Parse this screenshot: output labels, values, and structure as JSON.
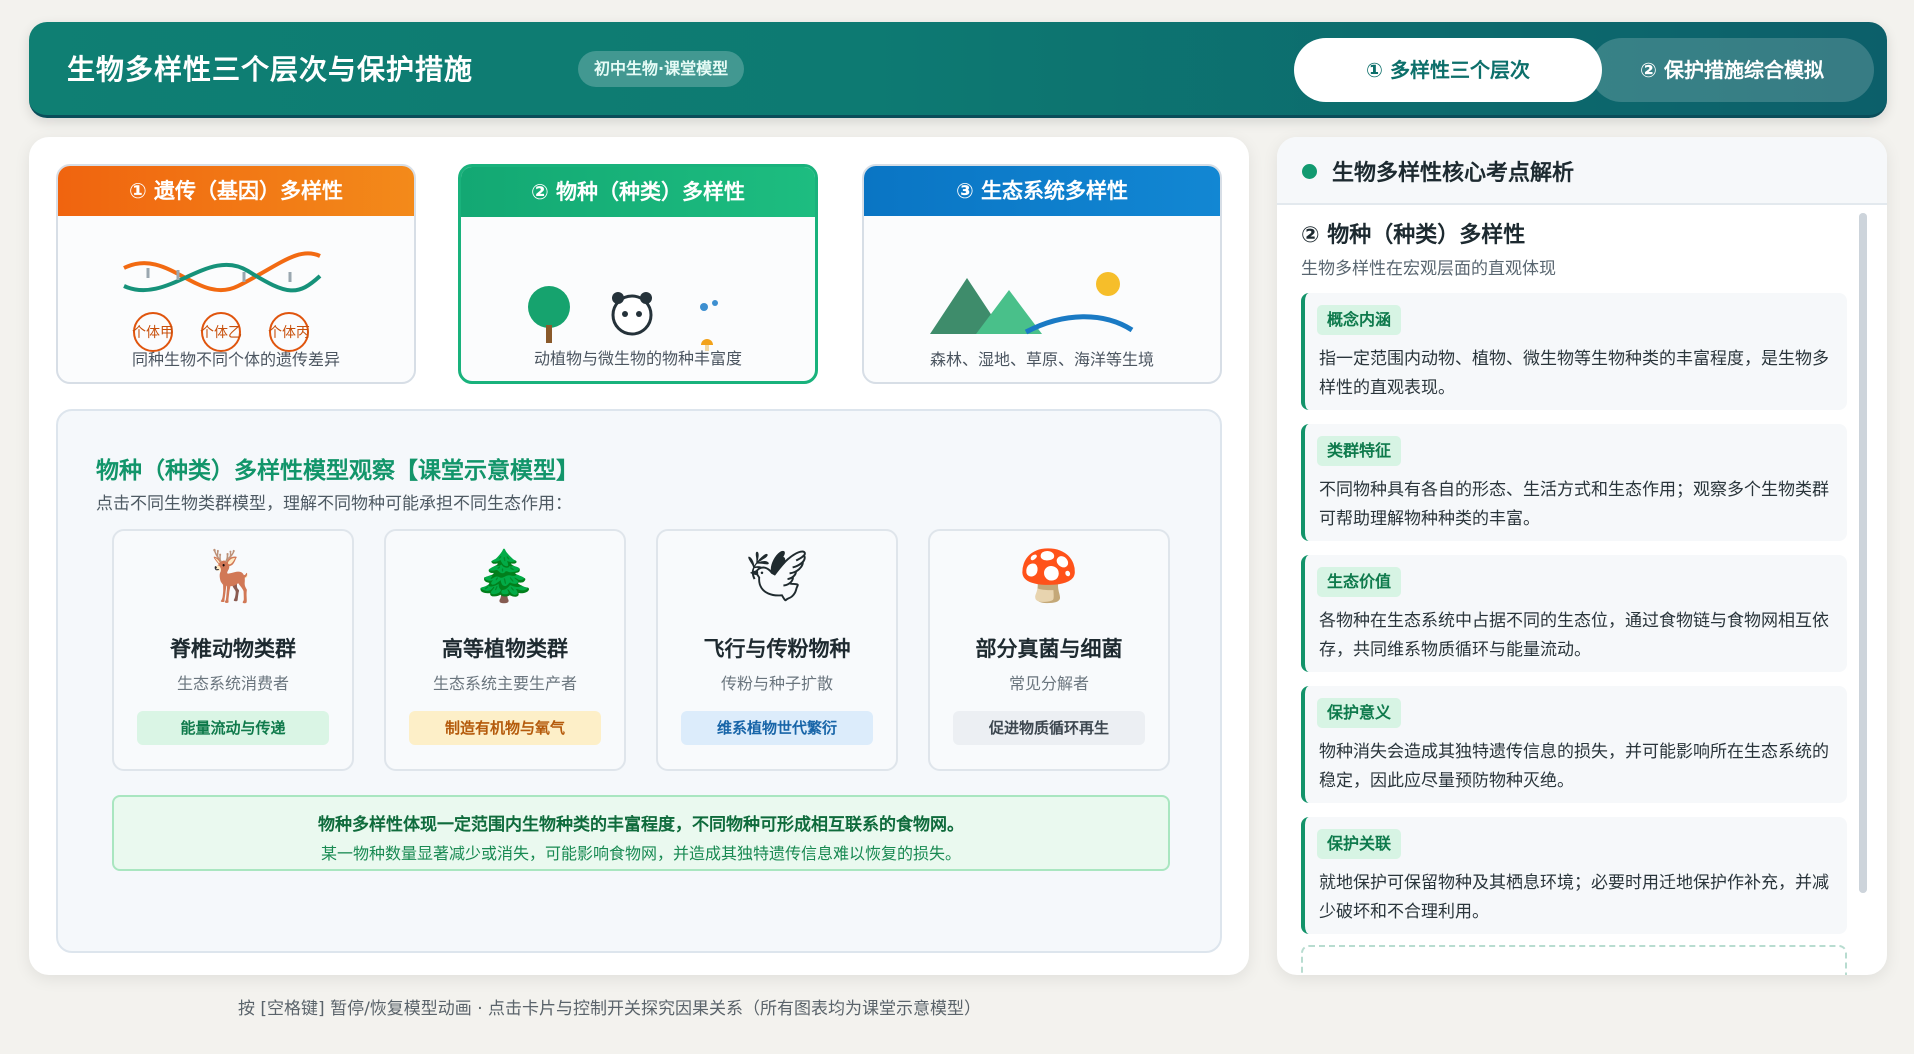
{
  "header": {
    "title": "生物多样性三个层次与保护措施",
    "tag": "初中生物·课堂模型",
    "tabs": [
      {
        "label": "① 多样性三个层次"
      },
      {
        "label": "② 保护措施综合模拟"
      }
    ]
  },
  "levels": [
    {
      "title": "① 遗传（基因）多样性",
      "desc": "同种生物不同个体的遗传差异",
      "individuals": [
        "个体甲",
        "个体乙",
        "个体丙"
      ],
      "color": "#f26a12"
    },
    {
      "title": "② 物种（种类）多样性",
      "desc": "动植物与微生物的物种丰富度",
      "color": "#15ad77",
      "active": true
    },
    {
      "title": "③ 生态系统多样性",
      "desc": "森林、湿地、草原、海洋等生境",
      "color": "#0a78c6"
    }
  ],
  "model": {
    "title": "物种（种类）多样性模型观察【课堂示意模型】",
    "subtitle": "点击不同生物类群模型，理解不同物种可能承担不同生态作用：",
    "groups": [
      {
        "icon": "🦌",
        "icon_name": "deer-icon",
        "name": "脊椎动物类群",
        "role": "生态系统消费者",
        "badge": "能量流动与传递"
      },
      {
        "icon": "🌲",
        "icon_name": "tree-icon",
        "name": "高等植物类群",
        "role": "生态系统主要生产者",
        "badge": "制造有机物与氧气"
      },
      {
        "icon": "🕊",
        "icon_name": "dove-icon",
        "name": "飞行与传粉物种",
        "role": "传粉与种子扩散",
        "badge": "维系植物世代繁衍"
      },
      {
        "icon": "🍄",
        "icon_name": "mushroom-icon",
        "name": "部分真菌与细菌",
        "role": "常见分解者",
        "badge": "促进物质循环再生"
      }
    ],
    "summary_line1": "物种多样性体现一定范围内生物种类的丰富程度，不同物种可形成相互联系的食物网。",
    "summary_line2": "某一物种数量显著减少或消失，可能影响食物网，并造成其独特遗传信息难以恢复的损失。"
  },
  "side": {
    "title": "生物多样性核心考点解析",
    "level_title": "② 物种（种类）多样性",
    "level_desc": "生物多样性在宏观层面的直观体现",
    "points": [
      {
        "tag": "概念内涵",
        "text": "指一定范围内动物、植物、微生物等生物种类的丰富程度，是生物多样性的直观表现。"
      },
      {
        "tag": "类群特征",
        "text": "不同物种具有各自的形态、生活方式和生态作用；观察多个生物类群可帮助理解物种种类的丰富。"
      },
      {
        "tag": "生态价值",
        "text": "各物种在生态系统中占据不同的生态位，通过食物链与食物网相互依存，共同维系物质循环与能量流动。"
      },
      {
        "tag": "保护意义",
        "text": "物种消失会造成其独特遗传信息的损失，并可能影响所在生态系统的稳定，因此应尽量预防物种灭绝。"
      },
      {
        "tag": "保护关联",
        "text": "就地保护可保留物种及其栖息环境；必要时用迁地保护作补充，并减少破坏和不合理利用。"
      }
    ]
  },
  "footer": "按 [空格键] 暂停/恢复模型动画 · 点击卡片与控制开关探究因果关系（所有图表均为课堂示意模型）"
}
